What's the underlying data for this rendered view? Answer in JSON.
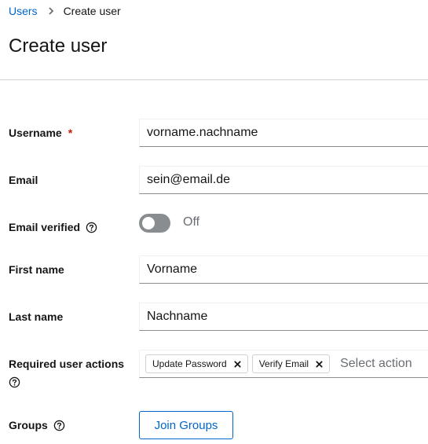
{
  "breadcrumb": {
    "parent": "Users",
    "current": "Create user"
  },
  "page": {
    "title": "Create user"
  },
  "form": {
    "username": {
      "label": "Username",
      "required_mark": "*",
      "value": "vorname.nachname"
    },
    "email": {
      "label": "Email",
      "value": "sein@email.de"
    },
    "email_verified": {
      "label": "Email verified",
      "state": "Off"
    },
    "first_name": {
      "label": "First name",
      "value": "Vorname"
    },
    "last_name": {
      "label": "Last name",
      "value": "Nachname"
    },
    "required_actions": {
      "label": "Required user actions",
      "chips": [
        "Update Password",
        "Verify Email"
      ],
      "placeholder": "Select action"
    },
    "groups": {
      "label": "Groups",
      "button": "Join Groups"
    }
  },
  "icons": {
    "help": "question-circle-icon",
    "breadcrumb_separator": "chevron-right-icon",
    "chip_remove": "times-icon"
  },
  "colors": {
    "link": "#0066cc",
    "required": "#c9190b",
    "toggle_off": "#8a8d90"
  }
}
